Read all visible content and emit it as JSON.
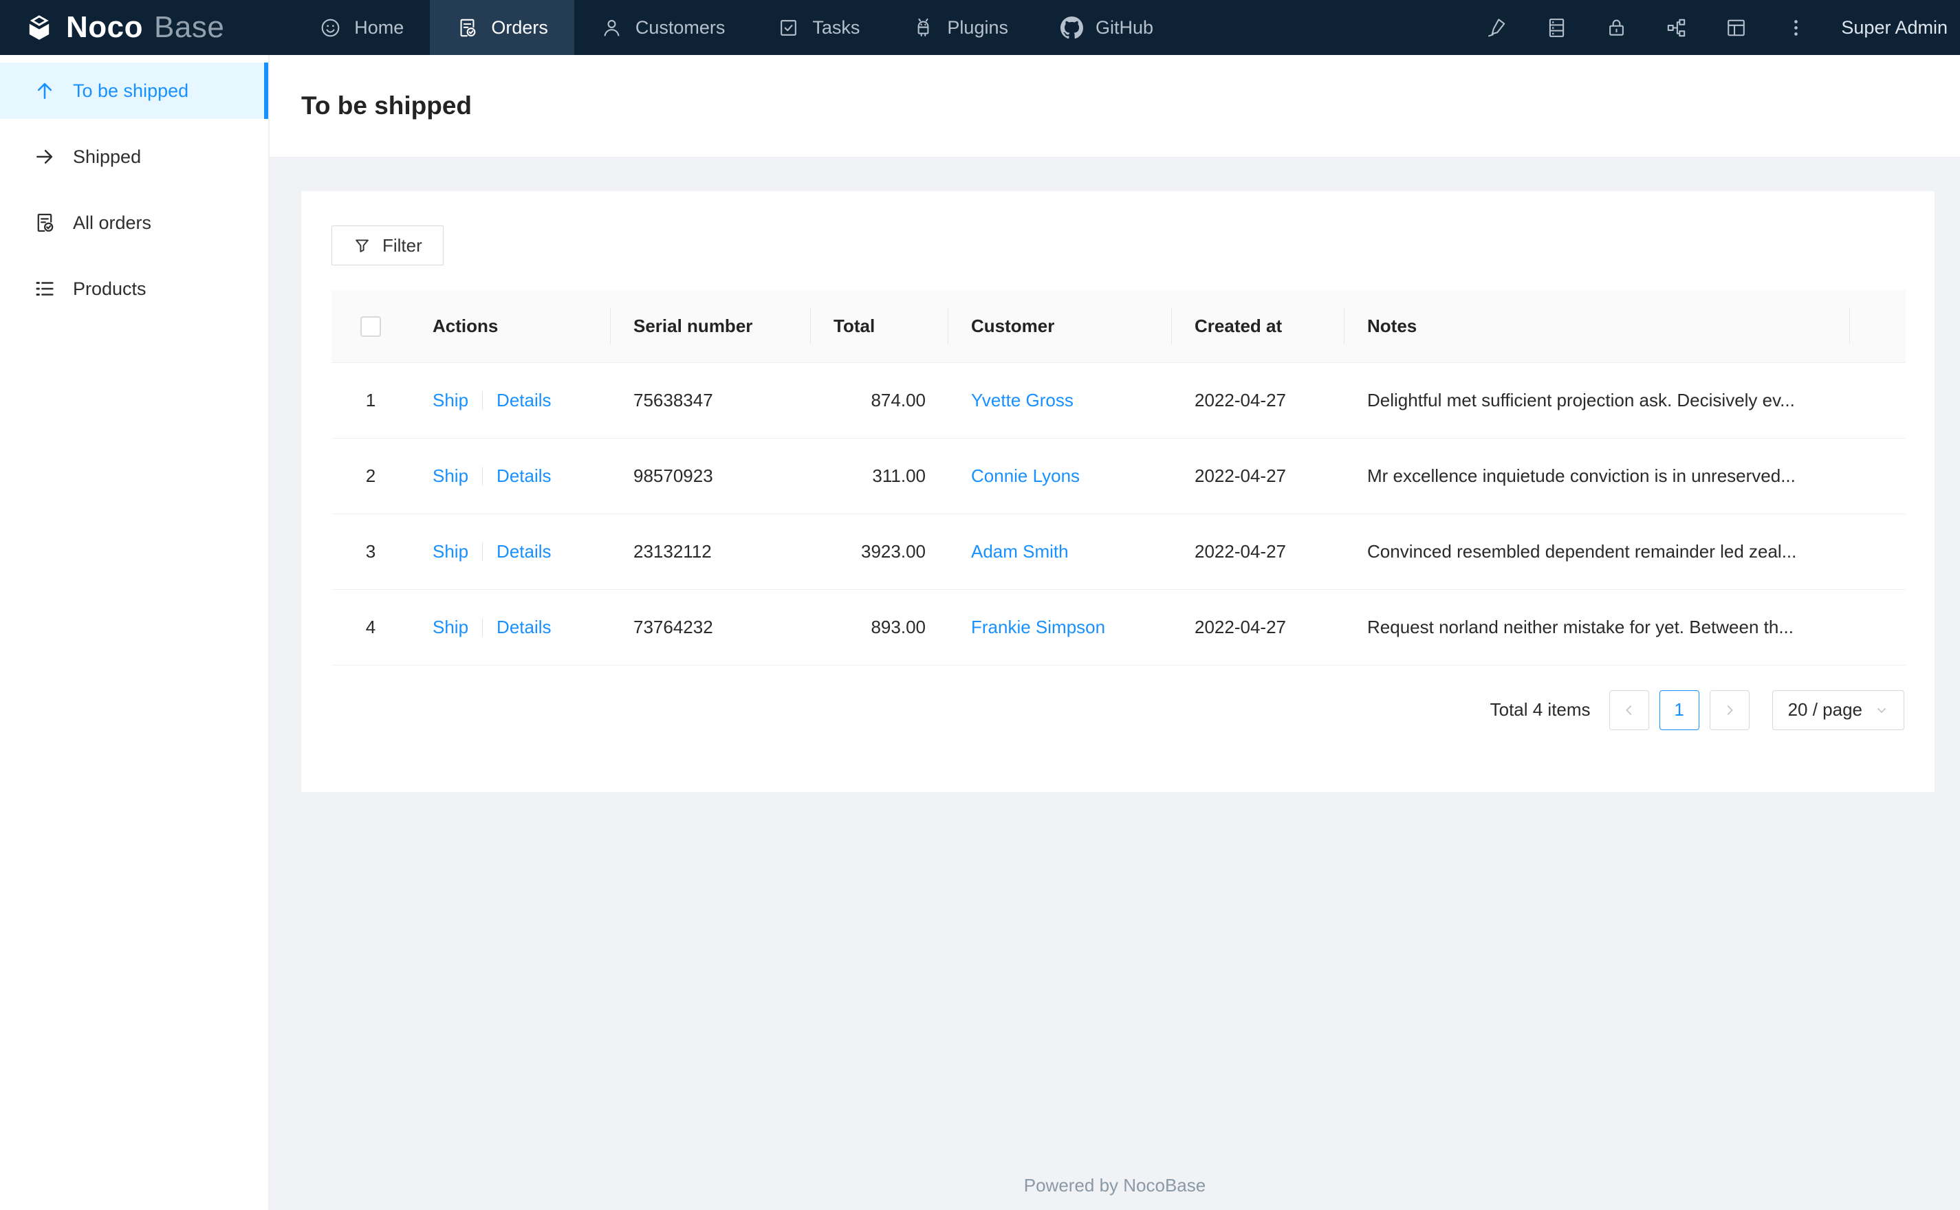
{
  "navbar": {
    "logo": {
      "noco": "Noco",
      "base": "Base"
    },
    "items": [
      {
        "label": "Home",
        "icon": "smile-icon",
        "active": false
      },
      {
        "label": "Orders",
        "icon": "file-done-icon",
        "active": true
      },
      {
        "label": "Customers",
        "icon": "user-icon",
        "active": false
      },
      {
        "label": "Tasks",
        "icon": "check-square-icon",
        "active": false
      },
      {
        "label": "Plugins",
        "icon": "android-icon",
        "active": false
      },
      {
        "label": "GitHub",
        "icon": "github-icon",
        "active": false
      }
    ],
    "right_icons": [
      "highlight-icon",
      "database-icon",
      "lock-icon",
      "partition-icon",
      "layout-icon",
      "ellipsis-vertical-icon"
    ],
    "user": "Super Admin"
  },
  "sidebar": {
    "items": [
      {
        "label": "To be shipped",
        "icon": "arrow-up-icon",
        "active": true
      },
      {
        "label": "Shipped",
        "icon": "arrow-right-icon",
        "active": false
      },
      {
        "label": "All orders",
        "icon": "file-done-icon",
        "active": false
      },
      {
        "label": "Products",
        "icon": "unordered-list-icon",
        "active": false
      }
    ]
  },
  "page": {
    "title": "To be shipped"
  },
  "toolbar": {
    "filter_label": "Filter"
  },
  "table": {
    "columns": [
      "Actions",
      "Serial number",
      "Total",
      "Customer",
      "Created at",
      "Notes"
    ],
    "rows": [
      {
        "index": "1",
        "actions": [
          "Ship",
          "Details"
        ],
        "serial": "75638347",
        "total": "874.00",
        "customer": "Yvette Gross",
        "created_at": "2022-04-27",
        "notes": "Delightful met sufficient projection ask. Decisively ev..."
      },
      {
        "index": "2",
        "actions": [
          "Ship",
          "Details"
        ],
        "serial": "98570923",
        "total": "311.00",
        "customer": "Connie Lyons",
        "created_at": "2022-04-27",
        "notes": "Mr excellence inquietude conviction is in unreserved..."
      },
      {
        "index": "3",
        "actions": [
          "Ship",
          "Details"
        ],
        "serial": "23132112",
        "total": "3923.00",
        "customer": "Adam Smith",
        "created_at": "2022-04-27",
        "notes": "Convinced resembled dependent remainder led zeal..."
      },
      {
        "index": "4",
        "actions": [
          "Ship",
          "Details"
        ],
        "serial": "73764232",
        "total": "893.00",
        "customer": "Frankie Simpson",
        "created_at": "2022-04-27",
        "notes": "Request norland neither mistake for yet. Between th..."
      }
    ]
  },
  "pagination": {
    "total_text": "Total 4 items",
    "current_page": "1",
    "page_size": "20 / page"
  },
  "footer": {
    "text": "Powered by NocoBase"
  },
  "colors": {
    "accent": "#1890ff",
    "navbar_bg": "#0e2235",
    "navbar_active_bg": "#253c55",
    "sidebar_active_bg": "#e6f7ff",
    "content_bg": "#f0f2f5",
    "table_header_bg": "#fafafa",
    "link": "#1890ff"
  }
}
